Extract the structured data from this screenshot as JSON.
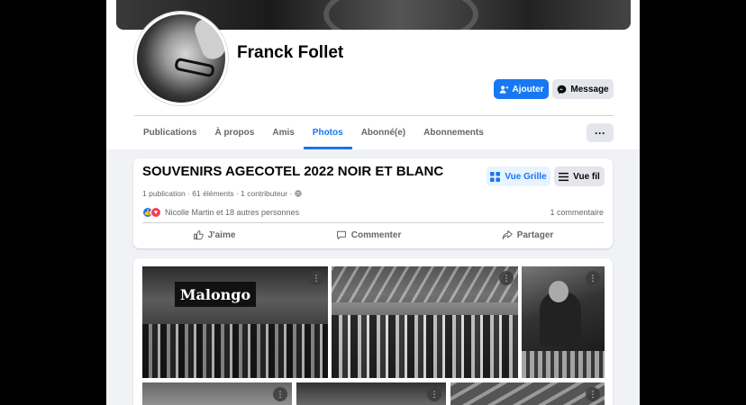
{
  "profile": {
    "name": "Franck Follet",
    "add_label": "Ajouter",
    "message_label": "Message"
  },
  "tabs": [
    {
      "label": "Publications",
      "active": false
    },
    {
      "label": "À propos",
      "active": false
    },
    {
      "label": "Amis",
      "active": false
    },
    {
      "label": "Photos",
      "active": true
    },
    {
      "label": "Abonné(e)",
      "active": false
    },
    {
      "label": "Abonnements",
      "active": false
    }
  ],
  "more_label": "···",
  "album": {
    "title": "SOUVENIRS AGECOTEL 2022 NOIR ET BLANC",
    "grid_label": "Vue Grille",
    "list_label": "Vue fil",
    "meta": "1 publication · 61 éléments · 1 contributeur · ",
    "reactions_text": "Nicolle Martin et 18 autres personnes",
    "comments_text": "1 commentaire",
    "like_label": "J'aime",
    "comment_label": "Commenter",
    "share_label": "Partager"
  },
  "photos": {
    "banner_text": "Malongo",
    "menu_glyph": "⋮"
  },
  "colors": {
    "accent": "#1877f2",
    "background": "#f0f2f5",
    "text_secondary": "#65676b"
  }
}
